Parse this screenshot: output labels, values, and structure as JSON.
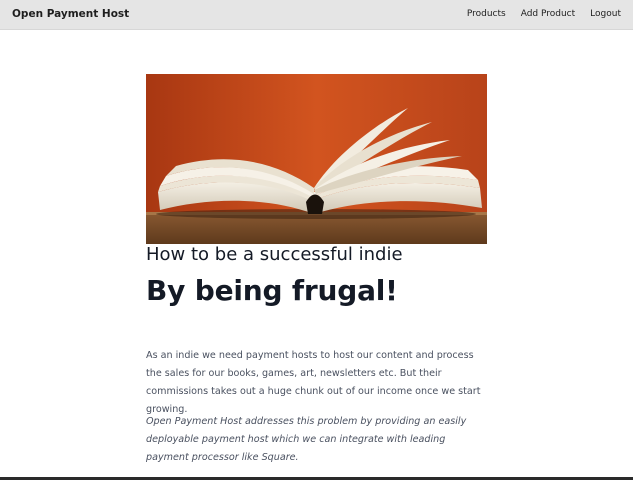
{
  "navbar": {
    "brand": "Open Payment Host",
    "links": [
      {
        "label": "Products"
      },
      {
        "label": "Add Product"
      },
      {
        "label": "Logout"
      }
    ]
  },
  "hero": {
    "image": "open-book-photo"
  },
  "article": {
    "subtitle": "How to be a successful indie",
    "headline": "By being frugal!",
    "paragraphs": [
      "As an indie we need payment hosts to host our content and process the sales for our books, games, art, newsletters etc. But their commissions takes out a huge chunk out of our income once we start growing.",
      "Open Payment Host addresses this problem by providing an easily deployable payment host which we can integrate with leading payment processor like Square."
    ]
  },
  "colors": {
    "navbar_bg": "#e5e5e5",
    "hero_wall": "#c4491c",
    "heading_text": "#141a26",
    "body_text": "#4a5160"
  }
}
